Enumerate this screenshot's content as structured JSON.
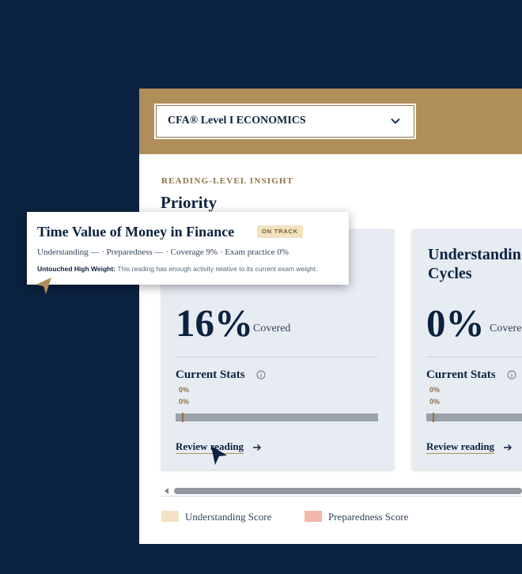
{
  "dropdown": {
    "selected": "CFA® Level I ECONOMICS",
    "icon": "chevron-down-icon"
  },
  "section": {
    "eyebrow": "READING-LEVEL INSIGHT",
    "title": "Priority"
  },
  "cards": [
    {
      "title": "",
      "coverage_value": "16%",
      "coverage_label": "Covered",
      "stats_title": "Current Stats",
      "stat_values": [
        "0%",
        "0%"
      ],
      "progress": 0.03,
      "review_label": "Review reading"
    },
    {
      "title_lines": [
        "Understandin",
        "Cycles"
      ],
      "coverage_value": "0%",
      "coverage_label": "Covere",
      "stats_title": "Current Stats",
      "stat_values": [
        "0%",
        "0%"
      ],
      "progress": 0.03,
      "review_label": "Review reading"
    }
  ],
  "legend": [
    {
      "label": "Understanding Score",
      "color": "#f1e3c3"
    },
    {
      "label": "Preparedness Score",
      "color": "#f2b7ad"
    }
  ],
  "tooltip": {
    "title": "Time Value of Money in Finance",
    "badge": "ON TRACK",
    "meta": "Understanding — · Preparedness — · Coverage 9% · Exam practice 0%",
    "note_label": "Untouched High Weight:",
    "note_text": " This reading has enough activity relative to its current exam weight."
  },
  "colors": {
    "background": "#0b2240",
    "header_gold": "#b08e59",
    "card_bg": "#e7ecf3",
    "navy": "#0b2240"
  }
}
